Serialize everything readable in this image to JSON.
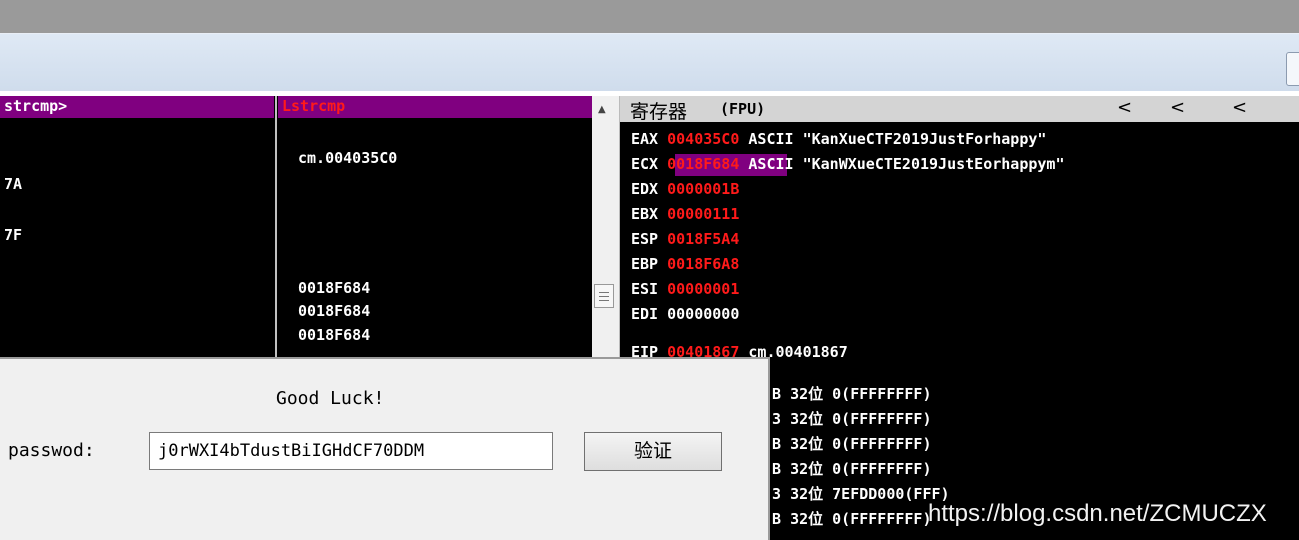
{
  "left_pane": {
    "col1_header": "strcmp>",
    "col2_header": "Lstrcmp",
    "col1_rows": [
      "7A",
      "7F"
    ],
    "col2_rows": [
      "cm.004035C0",
      "0018F684",
      "0018F684",
      "0018F684"
    ]
  },
  "registers": {
    "title": "寄存器",
    "mode": "(FPU)",
    "arrows": [
      "<",
      "<",
      "<"
    ],
    "rows": [
      {
        "name": "EAX",
        "value": "004035C0",
        "comment": "ASCII \"KanXueCTF2019JustForhappy\""
      },
      {
        "name": "ECX",
        "value": "0018F684",
        "comment": "ASCII \"KanWXueCTE2019JustEorhappym\""
      },
      {
        "name": "EDX",
        "value": "0000001B",
        "comment": ""
      },
      {
        "name": "EBX",
        "value": "00000111",
        "comment": ""
      },
      {
        "name": "ESP",
        "value": "0018F5A4",
        "comment": ""
      },
      {
        "name": "EBP",
        "value": "0018F6A8",
        "comment": ""
      },
      {
        "name": "ESI",
        "value": "00000001",
        "comment": ""
      },
      {
        "name": "EDI",
        "value": "00000000",
        "comment": ""
      },
      {
        "name": "EIP",
        "value": "00401867",
        "comment": "cm.00401867"
      }
    ],
    "segments": [
      {
        "prefix": "B",
        "bits": "32位",
        "value": "0(FFFFFFFF)"
      },
      {
        "prefix": "3",
        "bits": "32位",
        "value": "0(FFFFFFFF)"
      },
      {
        "prefix": "B",
        "bits": "32位",
        "value": "0(FFFFFFFF)"
      },
      {
        "prefix": "B",
        "bits": "32位",
        "value": "0(FFFFFFFF)"
      },
      {
        "prefix": "3",
        "bits": "32位",
        "value": "7EFDD000(FFF)"
      },
      {
        "prefix": "B",
        "bits": "32位",
        "value": "0(FFFFFFFF)"
      }
    ]
  },
  "dialog": {
    "message": "Good Luck!",
    "password_label": "passwod:",
    "password_value": "j0rWXI4bTdustBiIGHdCF70DDM",
    "verify_label": "验证"
  },
  "watermark": "https://blog.csdn.net/ZCMUCZX",
  "colors": {
    "header_purple": "#800080",
    "value_red": "#ff1a1a",
    "pane_bg": "#000000"
  }
}
